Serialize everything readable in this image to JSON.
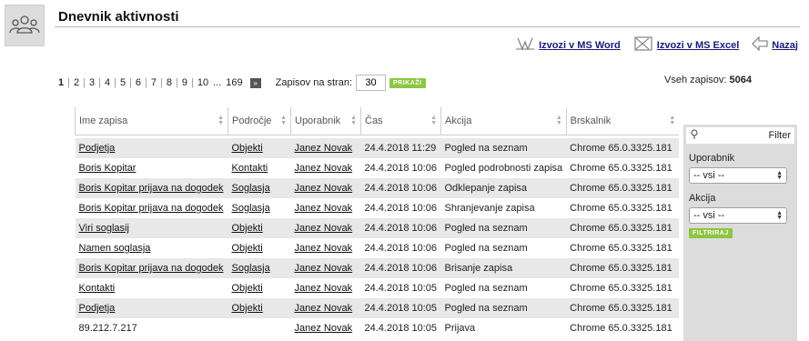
{
  "header": {
    "title": "Dnevnik aktivnosti",
    "icon": "users-icon"
  },
  "actions": [
    {
      "label": "Izvozi v MS Word",
      "icon": "word-icon"
    },
    {
      "label": "Izvozi v MS Excel",
      "icon": "excel-icon"
    },
    {
      "label": "Nazaj",
      "icon": "back-arrow-icon"
    }
  ],
  "pager": {
    "current": "1",
    "pages": [
      "2",
      "3",
      "4",
      "5",
      "6",
      "7",
      "8",
      "9",
      "10"
    ],
    "ellipsis": "...",
    "last": "169",
    "next_symbol": "»",
    "perpage_label": "Zapisov na stran:",
    "perpage_value": "30",
    "show_button": "PRIKAŽI"
  },
  "total": {
    "label": "Vseh zapisov:",
    "value": "5064"
  },
  "table": {
    "columns": [
      "Ime zapisa",
      "Področje",
      "Uporabnik",
      "Čas",
      "Akcija",
      "Brskalnik"
    ],
    "rows": [
      {
        "name": "Podjetja",
        "area": "Objekti",
        "user": "Janez Novak",
        "time": "24.4.2018 11:29",
        "action": "Pogled na seznam",
        "browser": "Chrome 65.0.3325.181"
      },
      {
        "name": "Boris Kopitar",
        "area": "Kontakti",
        "user": "Janez Novak",
        "time": "24.4.2018 10:06",
        "action": "Pogled podrobnosti zapisa",
        "browser": "Chrome 65.0.3325.181"
      },
      {
        "name": "Boris Kopitar prijava na dogodek",
        "area": "Soglasja",
        "user": "Janez Novak",
        "time": "24.4.2018 10:06",
        "action": "Odklepanje zapisa",
        "browser": "Chrome 65.0.3325.181"
      },
      {
        "name": "Boris Kopitar prijava na dogodek",
        "area": "Soglasja",
        "user": "Janez Novak",
        "time": "24.4.2018 10:06",
        "action": "Shranjevanje zapisa",
        "browser": "Chrome 65.0.3325.181"
      },
      {
        "name": "Viri soglasij",
        "area": "Objekti",
        "user": "Janez Novak",
        "time": "24.4.2018 10:06",
        "action": "Pogled na seznam",
        "browser": "Chrome 65.0.3325.181"
      },
      {
        "name": "Namen soglasja",
        "area": "Objekti",
        "user": "Janez Novak",
        "time": "24.4.2018 10:06",
        "action": "Pogled na seznam",
        "browser": "Chrome 65.0.3325.181"
      },
      {
        "name": "Boris Kopitar prijava na dogodek",
        "area": "Soglasja",
        "user": "Janez Novak",
        "time": "24.4.2018 10:06",
        "action": "Brisanje zapisa",
        "browser": "Chrome 65.0.3325.181"
      },
      {
        "name": "Kontakti",
        "area": "Objekti",
        "user": "Janez Novak",
        "time": "24.4.2018 10:05",
        "action": "Pogled na seznam",
        "browser": "Chrome 65.0.3325.181"
      },
      {
        "name": "Podjetja",
        "area": "Objekti",
        "user": "Janez Novak",
        "time": "24.4.2018 10:05",
        "action": "Pogled na seznam",
        "browser": "Chrome 65.0.3325.181"
      },
      {
        "name": "89.212.7.217",
        "area": "",
        "user": "Janez Novak",
        "time": "24.4.2018 10:05",
        "action": "Prijava",
        "browser": "Chrome 65.0.3325.181"
      }
    ]
  },
  "filter": {
    "title": "Filter",
    "user_label": "Uporabnik",
    "user_value": "-- vsi --",
    "action_label": "Akcija",
    "action_value": "-- vsi --",
    "apply_button": "FILTRIRAJ"
  }
}
